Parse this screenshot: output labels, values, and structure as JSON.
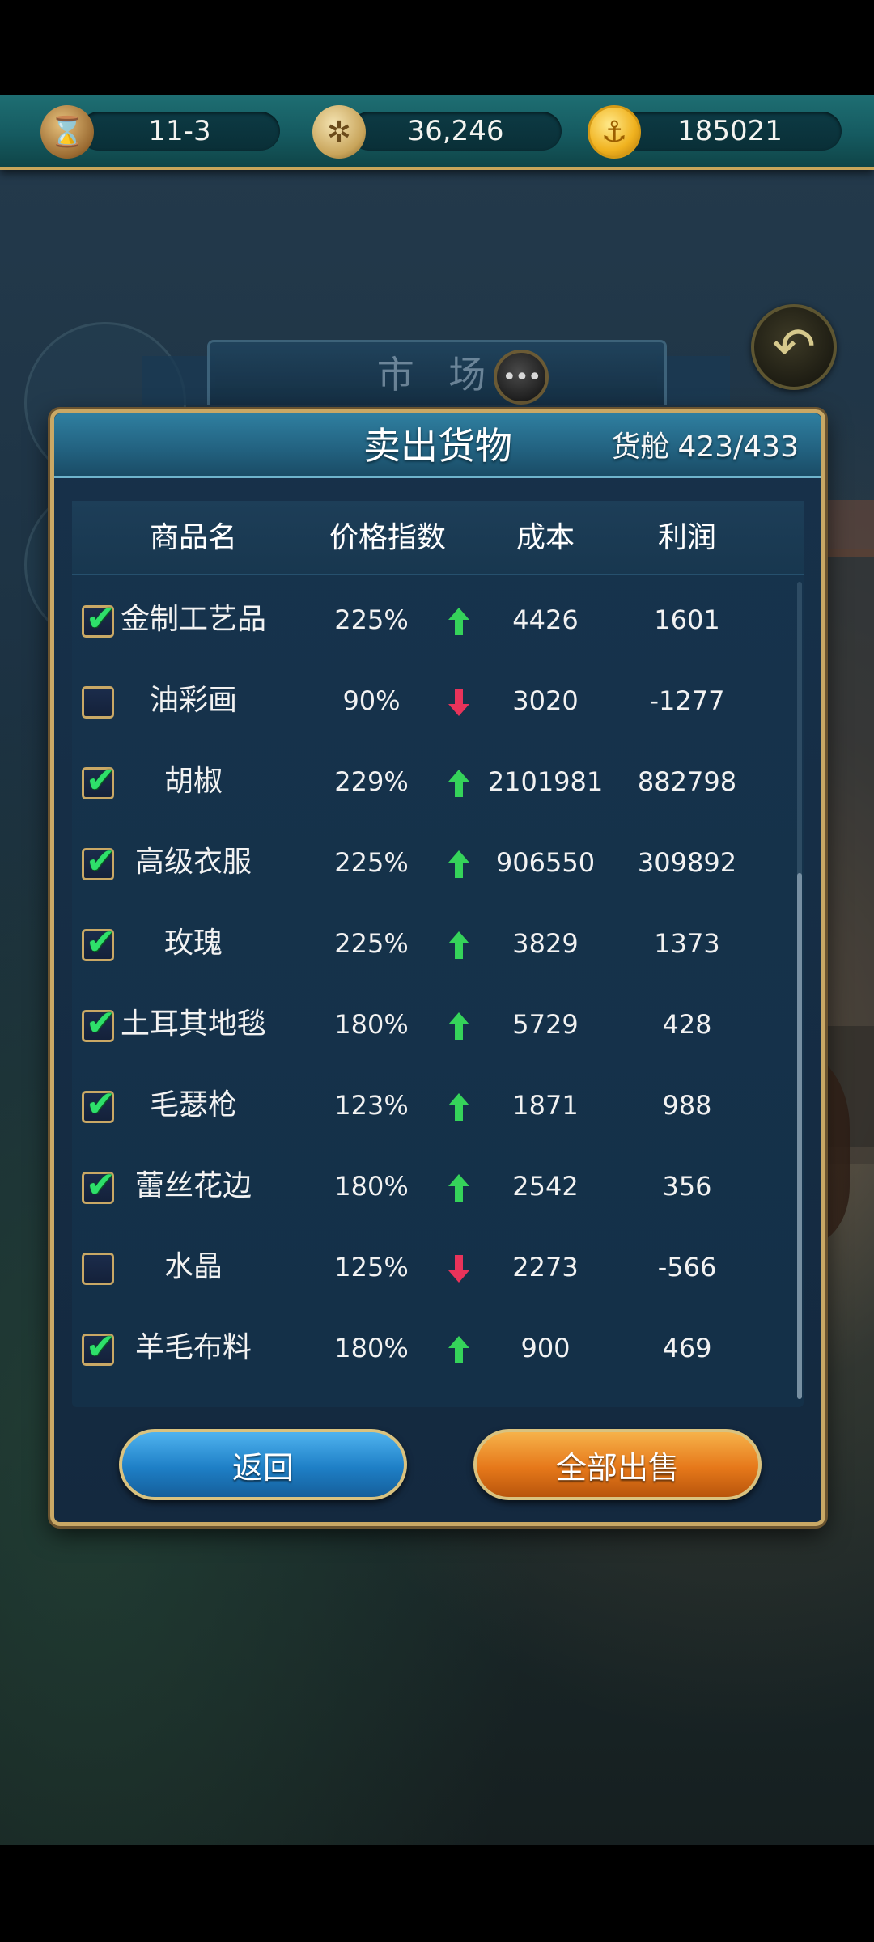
{
  "resources": {
    "date": "11-3",
    "fame": "36,246",
    "gold": "185021"
  },
  "market": {
    "title": "市 场"
  },
  "panel": {
    "title": "卖出货物",
    "cargo_label": "货舱",
    "cargo_value": "423/433"
  },
  "table": {
    "headers": [
      "商品名",
      "价格指数",
      "成本",
      "利润"
    ],
    "rows": [
      {
        "name": "金制工艺品",
        "checked": true,
        "price_index": "225%",
        "trend": "up",
        "cost": "4426",
        "profit": "1601"
      },
      {
        "name": "油彩画",
        "checked": false,
        "price_index": "90%",
        "trend": "down",
        "cost": "3020",
        "profit": "-1277"
      },
      {
        "name": "胡椒",
        "checked": true,
        "price_index": "229%",
        "trend": "up",
        "cost": "2101981",
        "profit": "882798"
      },
      {
        "name": "高级衣服",
        "checked": true,
        "price_index": "225%",
        "trend": "up",
        "cost": "906550",
        "profit": "309892"
      },
      {
        "name": "玫瑰",
        "checked": true,
        "price_index": "225%",
        "trend": "up",
        "cost": "3829",
        "profit": "1373"
      },
      {
        "name": "土耳其地毯",
        "checked": true,
        "price_index": "180%",
        "trend": "up",
        "cost": "5729",
        "profit": "428"
      },
      {
        "name": "毛瑟枪",
        "checked": true,
        "price_index": "123%",
        "trend": "up",
        "cost": "1871",
        "profit": "988"
      },
      {
        "name": "蕾丝花边",
        "checked": true,
        "price_index": "180%",
        "trend": "up",
        "cost": "2542",
        "profit": "356"
      },
      {
        "name": "水晶",
        "checked": false,
        "price_index": "125%",
        "trend": "down",
        "cost": "2273",
        "profit": "-566"
      },
      {
        "name": "羊毛布料",
        "checked": true,
        "price_index": "180%",
        "trend": "up",
        "cost": "900",
        "profit": "469"
      }
    ]
  },
  "buttons": {
    "back": "返回",
    "sell_all": "全部出售"
  },
  "colors": {
    "trend_up": "#35d35a",
    "trend_down": "#e8335a",
    "panel_border": "#c9a865"
  },
  "icons": {
    "date": "hourglass-icon",
    "fame": "compass-icon",
    "gold": "gold-anchor-coin-icon",
    "back": "back-arrow-icon",
    "chat": "chat-bubble-icon"
  }
}
